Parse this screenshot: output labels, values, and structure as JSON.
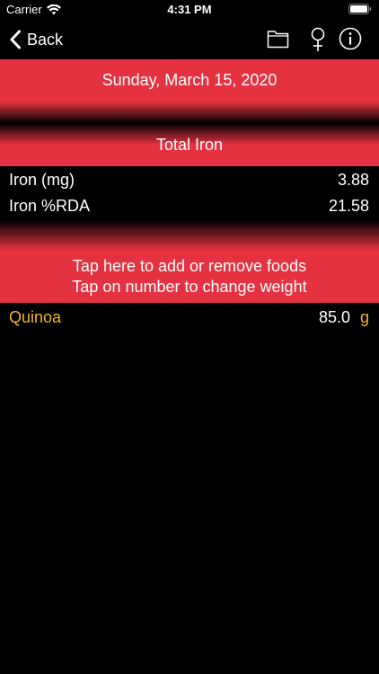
{
  "status_bar": {
    "carrier": "Carrier",
    "time": "4:31 PM"
  },
  "nav": {
    "back_label": "Back",
    "icons": [
      "chevron-left-icon",
      "folder-icon",
      "female-symbol-icon",
      "info-icon"
    ]
  },
  "date_header": "Sunday, March 15, 2020",
  "total_header": "Total Iron",
  "nutrients": [
    {
      "label": "Iron (mg)",
      "value": "3.88"
    },
    {
      "label": "Iron %RDA",
      "value": "21.58"
    }
  ],
  "instructions": {
    "line1": "Tap here to add or remove foods",
    "line2": "Tap on number to change weight"
  },
  "foods": [
    {
      "name": "Quinoa",
      "weight": "85.0",
      "unit": "g"
    }
  ],
  "colors": {
    "accent": "#e43240",
    "food_text": "#f4b324",
    "background": "#000000",
    "text": "#ffffff"
  }
}
